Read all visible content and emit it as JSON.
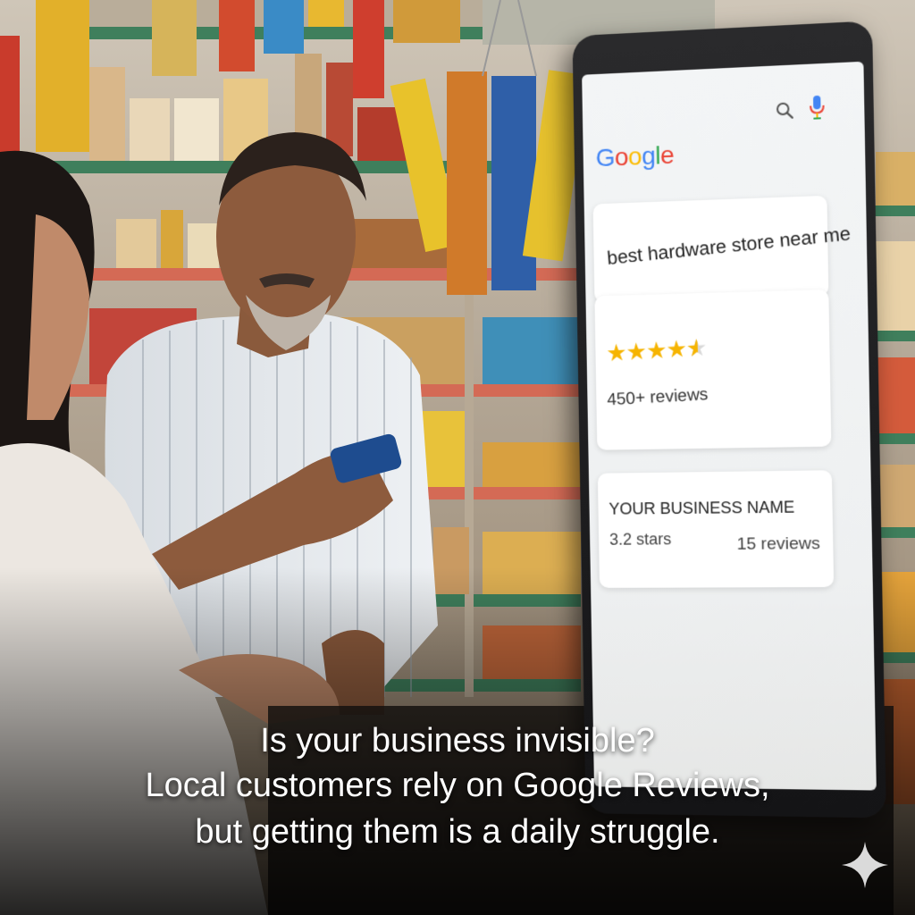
{
  "tablet": {
    "search_query": "best hardware store near me",
    "logo_letters": [
      {
        "char": "G",
        "color": "#4285F4"
      },
      {
        "char": "o",
        "color": "#EA4335"
      },
      {
        "char": "o",
        "color": "#FBBC05"
      },
      {
        "char": "g",
        "color": "#4285F4"
      },
      {
        "char": "l",
        "color": "#34A853"
      },
      {
        "char": "e",
        "color": "#EA4335"
      }
    ],
    "top_result": {
      "rating_stars": 4.5,
      "reviews": "450+ reviews"
    },
    "your_business": {
      "name": "YOUR BUSINESS NAME",
      "stars": "3.2 stars",
      "reviews": "15 reviews"
    },
    "icons": [
      "search-icon",
      "mic-icon"
    ]
  },
  "caption": {
    "line1": "Is your business invisible?",
    "line2": "Local customers rely on Google Reviews,",
    "line3": "but getting them is a daily struggle."
  },
  "colors": {
    "star": "#f6b400",
    "caption_text": "#ffffff"
  },
  "decor": {
    "corner_icon": "sparkle-icon"
  }
}
